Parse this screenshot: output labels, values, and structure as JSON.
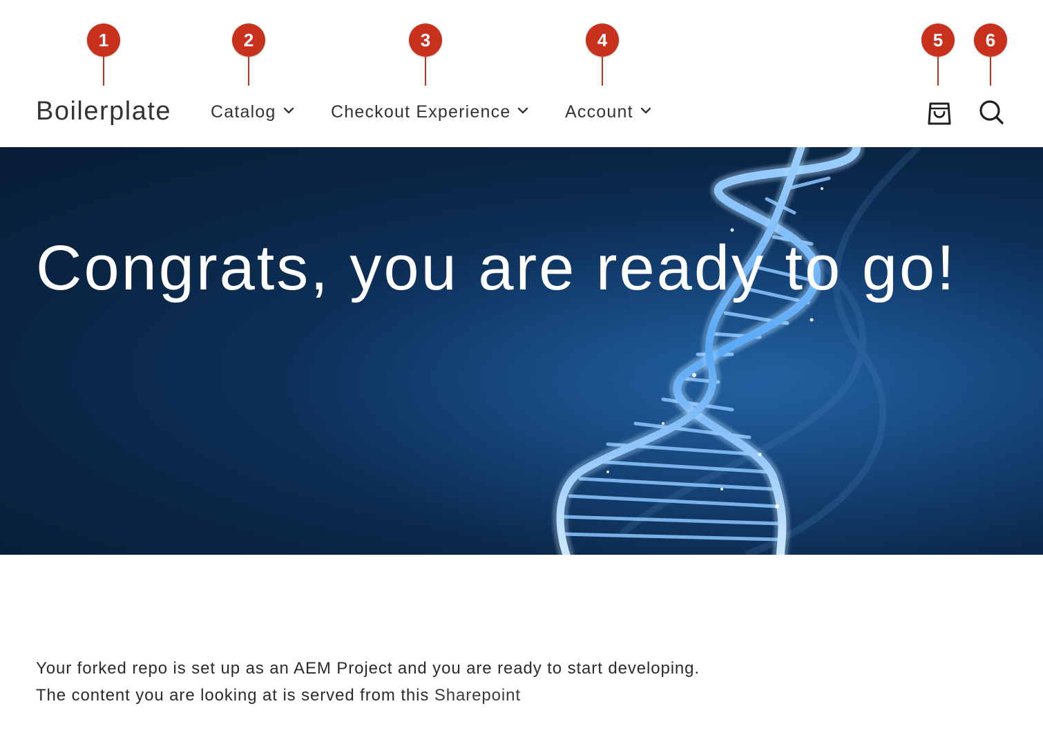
{
  "header": {
    "brand": "Boilerplate",
    "nav": [
      {
        "label": "Catalog",
        "icon": "chevron-down-icon"
      },
      {
        "label": "Checkout Experience",
        "icon": "chevron-down-icon"
      },
      {
        "label": "Account",
        "icon": "chevron-down-icon"
      }
    ],
    "cart_icon": "shopping-bag-icon",
    "search_icon": "search-icon"
  },
  "annotations": [
    "1",
    "2",
    "3",
    "4",
    "5",
    "6"
  ],
  "hero": {
    "title": "Congrats, you are ready to go!",
    "image": "dna-helix-illustration"
  },
  "content": {
    "line1": "Your forked repo is set up as an AEM Project and you are ready to start developing.",
    "line2_prefix": "The content you are looking at is served from this ",
    "line2_link": "Sharepoint"
  },
  "colors": {
    "marker": "#c8311c",
    "hero_background": "#0a2544",
    "helix": "#6fb6ff",
    "text": "#2b2b2b"
  }
}
